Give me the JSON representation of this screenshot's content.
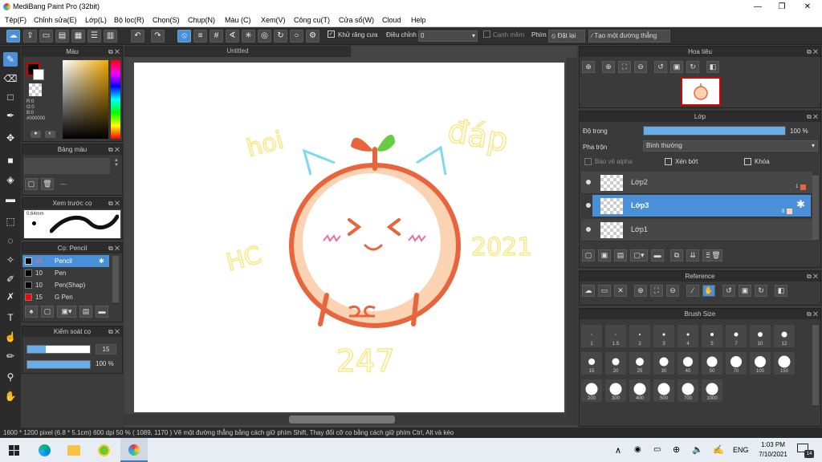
{
  "window": {
    "title": "MediBang Paint Pro (32bit)",
    "minimize": "—",
    "restore": "❐",
    "close": "✕"
  },
  "menu": [
    "Tệp(F)",
    "Chỉnh sửa(E)",
    "Lớp(L)",
    "Bộ lọc(R)",
    "Chọn(S)",
    "Chụp(N)",
    "Màu (C)",
    "Xem(V)",
    "Công cụ(T)",
    "Cửa sổ(W)",
    "Cloud",
    "Help"
  ],
  "toolbar": {
    "antialias_label": "Khử răng cưa",
    "correction_label": "Điều chỉnh",
    "correction_value": "0",
    "edge_label": "Cạnh mềm",
    "pen_label": "Phím",
    "reset_label": "Đặt lại",
    "straight_label": "Tạo một đường thẳng"
  },
  "document": {
    "tab": "Untitled"
  },
  "color_panel": {
    "title": "Màu",
    "r": "R:0",
    "g": "G:0",
    "b": "B:0",
    "hex": "#000000"
  },
  "palette_panel": {
    "title": "Bảng màu",
    "dash": "---"
  },
  "brush_preview": {
    "title": "Xem trước cọ",
    "size": "0.64mm"
  },
  "brush_panel": {
    "title": "Cọ: Pencil",
    "items": [
      {
        "size": "15",
        "name": "Pencil",
        "color": "#000000"
      },
      {
        "size": "10",
        "name": "Pen",
        "color": "#000000"
      },
      {
        "size": "10",
        "name": "Pen(Shap)",
        "color": "#000000"
      },
      {
        "size": "15",
        "name": "G Pen",
        "color": "#ff0000"
      }
    ]
  },
  "brush_control": {
    "title": "Kiểm soát cọ",
    "size": "15",
    "opacity": "100 %"
  },
  "navigator": {
    "title": "Hoa tiêu"
  },
  "layer_panel": {
    "title": "Lớp",
    "opacity_label": "Độ trong",
    "opacity_value": "100 %",
    "blend_label": "Pha trộn",
    "blend_value": "Bình thường",
    "alpha_label": "Bảo vệ alpha",
    "clip_label": "Xén bớt",
    "lock_label": "Khóa",
    "layers": [
      {
        "name": "Lớp2",
        "num": "1",
        "selected": false
      },
      {
        "name": "Lớp3",
        "num": "8",
        "selected": true
      },
      {
        "name": "Lớp1",
        "num": "",
        "selected": false
      }
    ]
  },
  "reference": {
    "title": "Reference"
  },
  "brush_size": {
    "title": "Brush Size",
    "sizes": [
      "1",
      "1.5",
      "2",
      "3",
      "4",
      "5",
      "7",
      "10",
      "12",
      "15",
      "20",
      "25",
      "30",
      "40",
      "50",
      "70",
      "100",
      "150",
      "200",
      "300",
      "400",
      "500",
      "700",
      "1000"
    ]
  },
  "status": "1600 * 1200 pixel   (6.8 * 5.1cm)   600 dpi   50 %   ( 1089, 1170 )   Vẽ một đường thẳng bằng cách giữ phím Shift, Thay đổi cỡ cọ bằng cách giữ phím Ctrl, Alt và kéo",
  "drawing": {
    "t1": "hoi",
    "t2": "đáp",
    "t3": "HC",
    "t4": "2021",
    "t5": "247"
  },
  "taskbar": {
    "lang": "ENG",
    "time": "1:03 PM",
    "date": "7/10/2021",
    "notif": "14"
  },
  "colors": {
    "accent": "#4a90d9",
    "orange": "#e8643c",
    "peach": "#fbd3b3",
    "leaf": "#66cc44",
    "yellow": "#f7e98a",
    "cyan": "#7fd8f0"
  }
}
